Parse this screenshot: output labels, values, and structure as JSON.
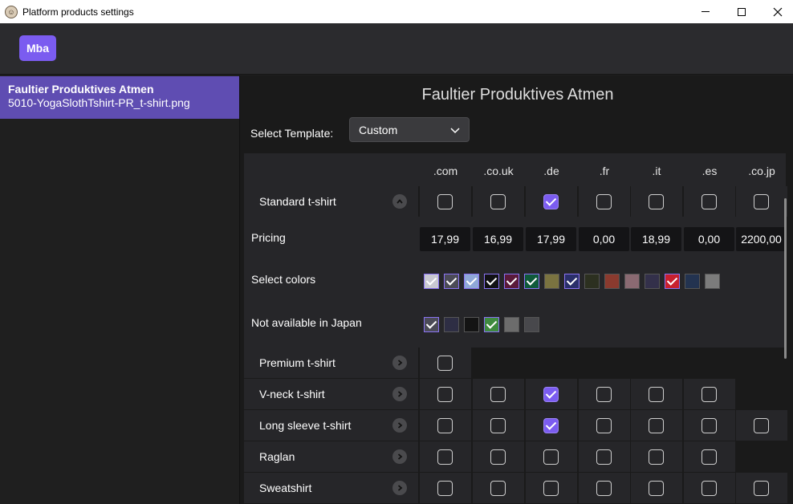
{
  "window": {
    "title": "Platform products settings"
  },
  "header": {
    "account_button": "Mba"
  },
  "sidebar": {
    "items": [
      {
        "title": "Faultier Produktives Atmen",
        "subtitle": "5010-YogaSlothTshirt-PR_t-shirt.png"
      }
    ]
  },
  "main": {
    "title": "Faultier Produktives Atmen",
    "template_label": "Select Template:",
    "template_value": "Custom",
    "tlds": [
      ".com",
      ".co.uk",
      ".de",
      ".fr",
      ".it",
      ".es",
      ".co.jp"
    ],
    "expanded_product": {
      "name": "Standard t-shirt",
      "checks": [
        false,
        false,
        true,
        false,
        false,
        false,
        false
      ],
      "pricing_label": "Pricing",
      "prices": [
        "17,99",
        "16,99",
        "17,99",
        "0,00",
        "18,99",
        "0,00",
        "2200,00"
      ],
      "colors_label": "Select colors",
      "colors": [
        {
          "hex": "#c9c9d2",
          "selected": true
        },
        {
          "hex": "#4b4b57",
          "selected": true
        },
        {
          "hex": "#8fa8d8",
          "selected": true
        },
        {
          "hex": "#111114",
          "selected": true
        },
        {
          "hex": "#5a1a3a",
          "selected": true
        },
        {
          "hex": "#0f5a3a",
          "selected": true
        },
        {
          "hex": "#7a7340",
          "selected": false
        },
        {
          "hex": "#2a2f6a",
          "selected": true
        },
        {
          "hex": "#2c3020",
          "selected": false
        },
        {
          "hex": "#8a3a2e",
          "selected": false
        },
        {
          "hex": "#8a6a72",
          "selected": false
        },
        {
          "hex": "#33304a",
          "selected": false
        },
        {
          "hex": "#c8202e",
          "selected": true
        },
        {
          "hex": "#233350",
          "selected": false
        },
        {
          "hex": "#7c7c7c",
          "selected": false
        }
      ],
      "japan_label": "Not available in Japan",
      "japan_colors": [
        {
          "hex": "#4b4b57",
          "selected": true
        },
        {
          "hex": "#2e2e44",
          "selected": false
        },
        {
          "hex": "#141414",
          "selected": false
        },
        {
          "hex": "#3f8a3f",
          "selected": true
        },
        {
          "hex": "#6c6c6c",
          "selected": false
        },
        {
          "hex": "#48484c",
          "selected": false
        }
      ]
    },
    "products": [
      {
        "name": "Premium t-shirt",
        "checks": [
          false,
          null,
          null,
          null,
          null,
          null,
          null
        ]
      },
      {
        "name": "V-neck t-shirt",
        "checks": [
          false,
          false,
          true,
          false,
          false,
          false,
          null
        ]
      },
      {
        "name": "Long sleeve t-shirt",
        "checks": [
          false,
          false,
          true,
          false,
          false,
          false,
          false
        ]
      },
      {
        "name": "Raglan",
        "checks": [
          false,
          false,
          false,
          false,
          false,
          false,
          null
        ]
      },
      {
        "name": "Sweatshirt",
        "checks": [
          false,
          false,
          false,
          false,
          false,
          false,
          false
        ]
      }
    ]
  }
}
